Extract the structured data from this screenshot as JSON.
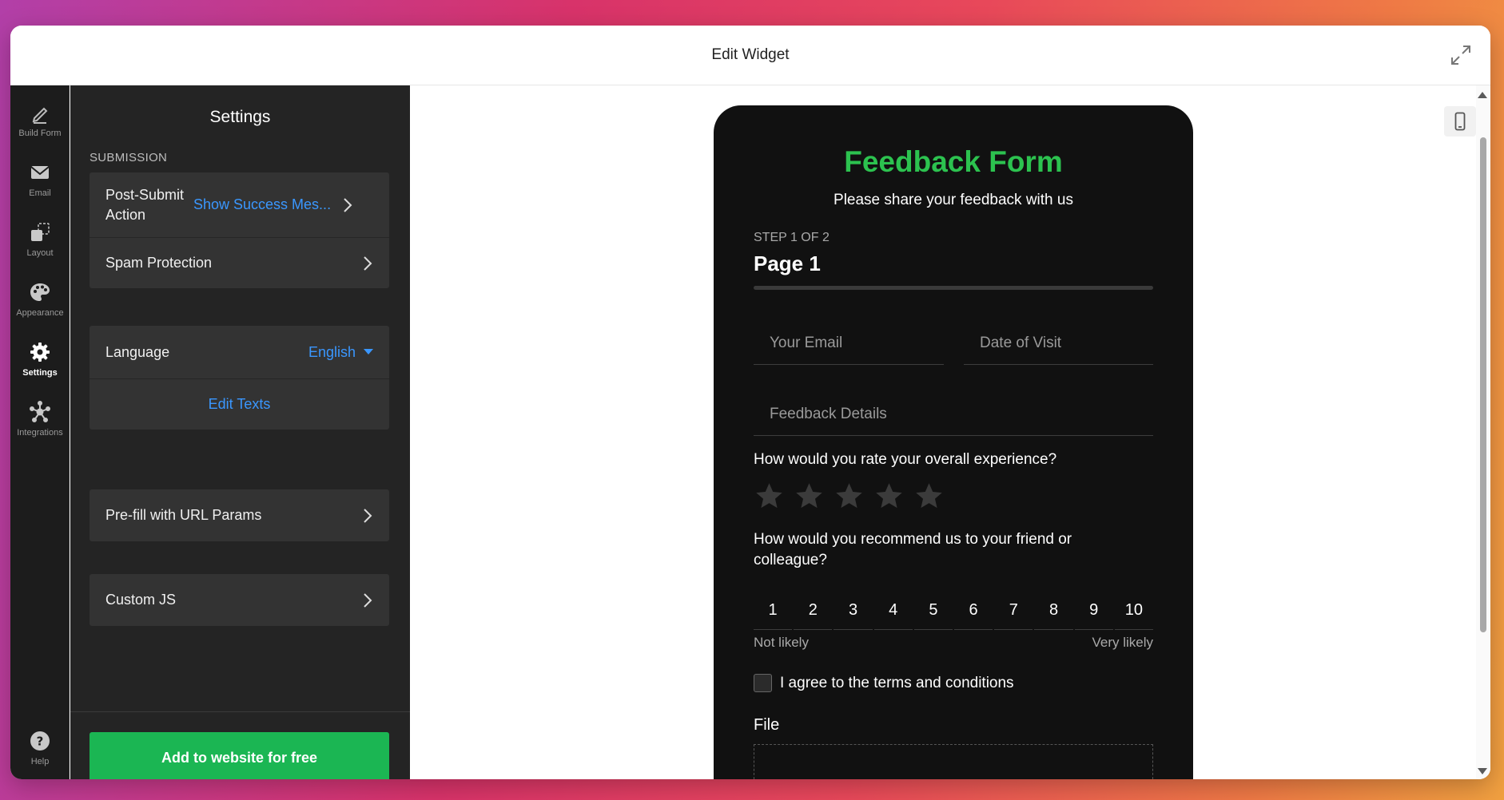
{
  "window": {
    "title": "Edit Widget"
  },
  "rail": {
    "items": [
      {
        "label": "Build Form",
        "icon": "pencil-icon"
      },
      {
        "label": "Email",
        "icon": "envelope-icon"
      },
      {
        "label": "Layout",
        "icon": "layout-icon"
      },
      {
        "label": "Appearance",
        "icon": "palette-icon"
      },
      {
        "label": "Settings",
        "icon": "gear-icon",
        "active": true
      },
      {
        "label": "Integrations",
        "icon": "integrations-icon"
      }
    ],
    "help_label": "Help"
  },
  "panel": {
    "title": "Settings",
    "section_label": "SUBMISSION",
    "post_submit": {
      "label": "Post-Submit Action",
      "value": "Show Success Mes..."
    },
    "spam_protection": {
      "label": "Spam Protection"
    },
    "language": {
      "label": "Language",
      "value": "English"
    },
    "edit_texts": "Edit Texts",
    "prefill": {
      "label": "Pre-fill with URL Params"
    },
    "custom_js": {
      "label": "Custom JS"
    },
    "cta": "Add to website for free"
  },
  "form": {
    "title": "Feedback Form",
    "subtitle": "Please share your feedback with us",
    "step": "STEP 1 OF 2",
    "page_name": "Page 1",
    "fields": {
      "email": "Your Email",
      "date": "Date of Visit",
      "details": "Feedback Details"
    },
    "rating_question": "How would you rate your overall experience?",
    "rating_max": 5,
    "rating_value": 0,
    "nps_question": "How would you recommend us to your friend or colleague?",
    "nps_scale": [
      "1",
      "2",
      "3",
      "4",
      "5",
      "6",
      "7",
      "8",
      "9",
      "10"
    ],
    "nps_low": "Not likely",
    "nps_high": "Very likely",
    "terms": "I agree to the terms and conditions",
    "terms_checked": false,
    "file_label": "File"
  },
  "colors": {
    "accent_green": "#2cc24f",
    "cta_green": "#1bb653",
    "link_blue": "#3a97ff",
    "panel_bg": "#242424",
    "form_bg": "#111111"
  }
}
